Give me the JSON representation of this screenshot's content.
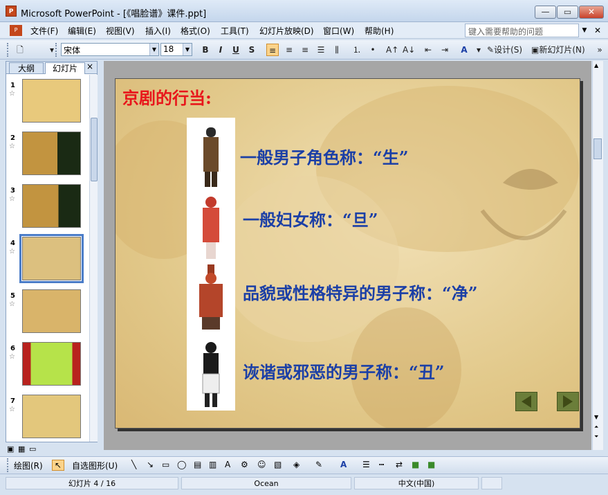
{
  "window": {
    "title": "Microsoft PowerPoint - [《唱脸谱》课件.ppt]",
    "icon": "powerpoint-icon"
  },
  "menu": {
    "items": [
      "文件(F)",
      "编辑(E)",
      "视图(V)",
      "插入(I)",
      "格式(O)",
      "工具(T)",
      "幻灯片放映(D)",
      "窗口(W)",
      "帮助(H)"
    ]
  },
  "help": {
    "placeholder": "键入需要帮助的问题"
  },
  "toolbar": {
    "font": "宋体",
    "size": "18",
    "bold": "B",
    "italic": "I",
    "underline": "U",
    "shadow": "S",
    "design": "设计(S)",
    "new_slide": "新幻灯片(N)"
  },
  "panel": {
    "tab_outline": "大纲",
    "tab_slides": "幻灯片",
    "close": "×"
  },
  "thumbnails": [
    {
      "num": "1",
      "star": "☆"
    },
    {
      "num": "2",
      "star": "☆"
    },
    {
      "num": "3",
      "star": "☆"
    },
    {
      "num": "4",
      "star": "☆",
      "selected": true
    },
    {
      "num": "5",
      "star": "☆"
    },
    {
      "num": "6",
      "star": "☆"
    },
    {
      "num": "7",
      "star": "☆"
    }
  ],
  "slide": {
    "title": "京剧的行当:",
    "lines": [
      "一般男子角色称：“生”",
      "一般妇女称：“旦”",
      "品貌或性格特异的男子称：“净”",
      "诙谐或邪恶的男子称：“丑”"
    ]
  },
  "drawbar": {
    "draw": "绘图(R)",
    "autoshapes": "自选图形(U)"
  },
  "status": {
    "slide": "幻灯片 4 / 16",
    "design": "Ocean",
    "language": "中文(中国)"
  }
}
